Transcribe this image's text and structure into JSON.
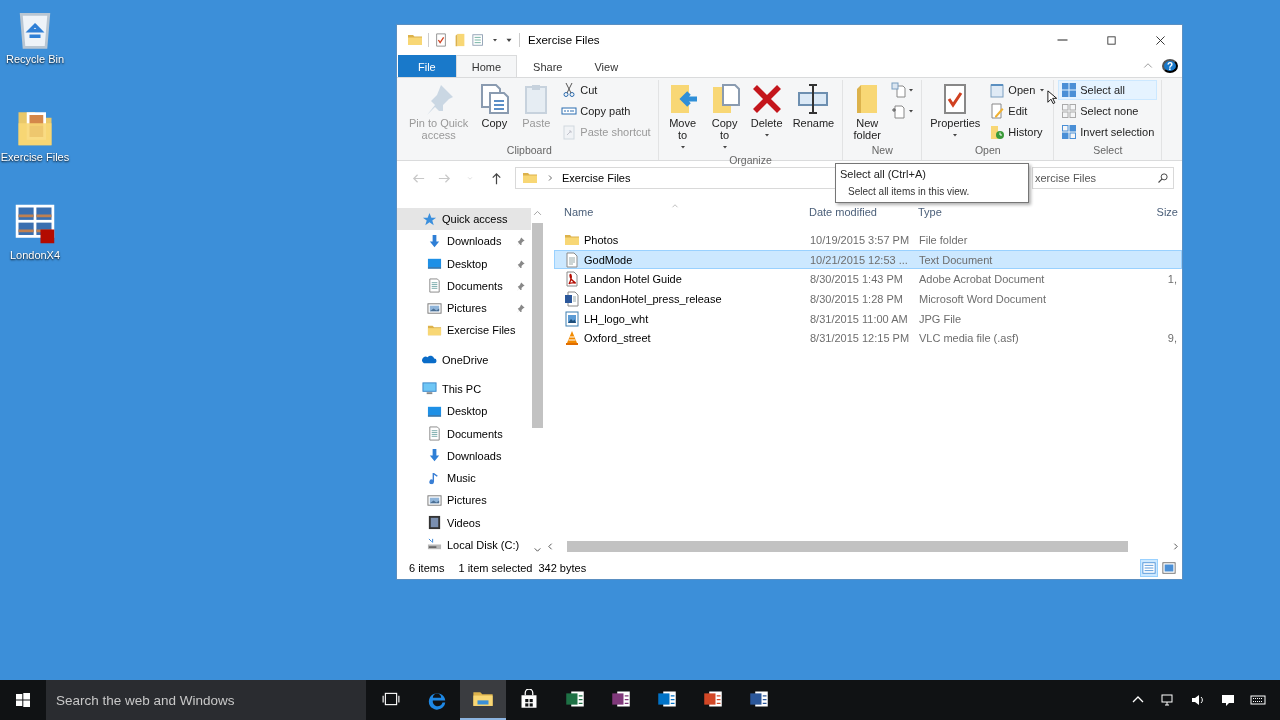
{
  "desktop_icons": [
    {
      "label": "Recycle Bin"
    },
    {
      "label": "Exercise Files"
    },
    {
      "label": "LondonX4"
    }
  ],
  "window": {
    "title": "Exercise Files",
    "help_label": "?"
  },
  "ribbon_tabs": [
    {
      "label": "File",
      "kind": "file",
      "selected": false
    },
    {
      "label": "Home",
      "kind": "tab",
      "selected": true
    },
    {
      "label": "Share",
      "kind": "tab",
      "selected": false
    },
    {
      "label": "View",
      "kind": "tab",
      "selected": false
    }
  ],
  "ribbon_groups": [
    {
      "label": "Clipboard",
      "items": [
        {
          "label": "Pin to Quick\naccess",
          "kind": "large",
          "disabled": true,
          "dropdown": false,
          "hovered": false
        },
        {
          "label": "Copy",
          "kind": "large",
          "disabled": false,
          "dropdown": false,
          "hovered": false
        },
        {
          "label": "Paste",
          "kind": "large",
          "disabled": true,
          "dropdown": false,
          "hovered": false
        },
        {
          "label": "Cut",
          "kind": "small",
          "disabled": false,
          "dropdown": false,
          "hovered": false
        },
        {
          "label": "Copy path",
          "kind": "small",
          "disabled": false,
          "dropdown": false,
          "hovered": false
        },
        {
          "label": "Paste shortcut",
          "kind": "small",
          "disabled": true,
          "dropdown": false,
          "hovered": false
        }
      ]
    },
    {
      "label": "Organize",
      "items": [
        {
          "label": "Move\nto",
          "kind": "large",
          "disabled": false,
          "dropdown": true,
          "hovered": false
        },
        {
          "label": "Copy\nto",
          "kind": "large",
          "disabled": false,
          "dropdown": true,
          "hovered": false
        },
        {
          "label": "Delete",
          "kind": "large",
          "disabled": false,
          "dropdown": true,
          "hovered": false
        },
        {
          "label": "Rename",
          "kind": "large",
          "disabled": false,
          "dropdown": false,
          "hovered": false
        }
      ]
    },
    {
      "label": "New",
      "items": [
        {
          "label": "New\nfolder",
          "kind": "large",
          "disabled": false,
          "dropdown": false,
          "hovered": false
        },
        {
          "kind": "icon",
          "disabled": false,
          "dropdown": true,
          "hovered": false
        },
        {
          "kind": "icon",
          "disabled": false,
          "dropdown": true,
          "hovered": false
        }
      ]
    },
    {
      "label": "Open",
      "items": [
        {
          "label": "Properties",
          "kind": "large",
          "disabled": false,
          "dropdown": true,
          "hovered": false
        },
        {
          "label": "Open",
          "kind": "small",
          "disabled": false,
          "dropdown": true,
          "hovered": false
        },
        {
          "label": "Edit",
          "kind": "small",
          "disabled": false,
          "dropdown": false,
          "hovered": false
        },
        {
          "label": "History",
          "kind": "small",
          "disabled": false,
          "dropdown": false,
          "hovered": false
        }
      ]
    },
    {
      "label": "Select",
      "items": [
        {
          "label": "Select all",
          "kind": "small",
          "disabled": false,
          "dropdown": false,
          "hovered": true
        },
        {
          "label": "Select none",
          "kind": "small",
          "disabled": false,
          "dropdown": false,
          "hovered": false
        },
        {
          "label": "Invert selection",
          "kind": "small",
          "disabled": false,
          "dropdown": false,
          "hovered": false
        }
      ]
    }
  ],
  "nav_buttons": [
    {
      "kind": "back",
      "disabled": true
    },
    {
      "kind": "forward",
      "disabled": true
    },
    {
      "kind": "recent",
      "disabled": true
    },
    {
      "kind": "up",
      "disabled": false
    }
  ],
  "address": {
    "path": "Exercise Files"
  },
  "search": {
    "placeholder": "xercise Files"
  },
  "navigation": [
    {
      "label": "Quick access",
      "selected": true,
      "children": [
        {
          "label": "Downloads",
          "pinned": true,
          "selected": false
        },
        {
          "label": "Desktop",
          "pinned": true,
          "selected": false
        },
        {
          "label": "Documents",
          "pinned": true,
          "selected": false
        },
        {
          "label": "Pictures",
          "pinned": true,
          "selected": false
        },
        {
          "label": "Exercise Files",
          "pinned": false,
          "selected": false
        }
      ]
    },
    {
      "label": "OneDrive",
      "selected": false
    },
    {
      "label": "This PC",
      "selected": false,
      "children": [
        {
          "label": "Desktop",
          "pinned": false,
          "selected": false
        },
        {
          "label": "Documents",
          "pinned": false,
          "selected": false
        },
        {
          "label": "Downloads",
          "pinned": false,
          "selected": false
        },
        {
          "label": "Music",
          "pinned": false,
          "selected": false
        },
        {
          "label": "Pictures",
          "pinned": false,
          "selected": false
        },
        {
          "label": "Videos",
          "pinned": false,
          "selected": false
        },
        {
          "label": "Local Disk (C:)",
          "pinned": false,
          "selected": false
        }
      ]
    }
  ],
  "columns": [
    {
      "label": "Name",
      "sorted": true
    },
    {
      "label": "Date modified",
      "sorted": false
    },
    {
      "label": "Type",
      "sorted": false
    },
    {
      "label": "Size",
      "sorted": false
    }
  ],
  "files": [
    {
      "name": "Photos",
      "date": "10/19/2015 3:57 PM",
      "type": "File folder",
      "kind": "folder",
      "selected": false
    },
    {
      "name": "GodMode",
      "date": "10/21/2015 12:53 ...",
      "type": "Text Document",
      "kind": "text",
      "selected": true
    },
    {
      "name": "Landon Hotel Guide",
      "date": "8/30/2015 1:43 PM",
      "type": "Adobe Acrobat Document",
      "size": "1,",
      "kind": "pdf",
      "selected": false
    },
    {
      "name": "LandonHotel_press_release",
      "date": "8/30/2015 1:28 PM",
      "type": "Microsoft Word Document",
      "kind": "word",
      "selected": false
    },
    {
      "name": "LH_logo_wht",
      "date": "8/31/2015 11:00 AM",
      "type": "JPG File",
      "kind": "image",
      "selected": false
    },
    {
      "name": "Oxford_street",
      "date": "8/31/2015 12:15 PM",
      "type": "VLC media file (.asf)",
      "size": "9,",
      "kind": "video",
      "selected": false
    }
  ],
  "status_bar": {
    "count": "6 items",
    "selection": "1 item selected",
    "size": "342 bytes"
  },
  "view_buttons": [
    {
      "kind": "details",
      "selected": true
    },
    {
      "kind": "tiles",
      "selected": false
    }
  ],
  "tooltip": {
    "title": "Select all (Ctrl+A)",
    "text": "Select all items in this view."
  },
  "taskbar": {
    "search_placeholder": "Search the web and Windows",
    "apps": [
      {
        "kind": "taskview",
        "active": false
      },
      {
        "kind": "browser",
        "active": false
      },
      {
        "kind": "explorer",
        "active": true
      },
      {
        "kind": "store",
        "active": false
      },
      {
        "kind": "sheet",
        "color": "#1e7145",
        "active": false
      },
      {
        "kind": "notes",
        "color": "#80397b",
        "active": false
      },
      {
        "kind": "mail",
        "color": "#0072c6",
        "active": false
      },
      {
        "kind": "slides",
        "color": "#d24726",
        "active": false
      },
      {
        "kind": "doc",
        "color": "#2b579a",
        "active": false
      }
    ]
  }
}
